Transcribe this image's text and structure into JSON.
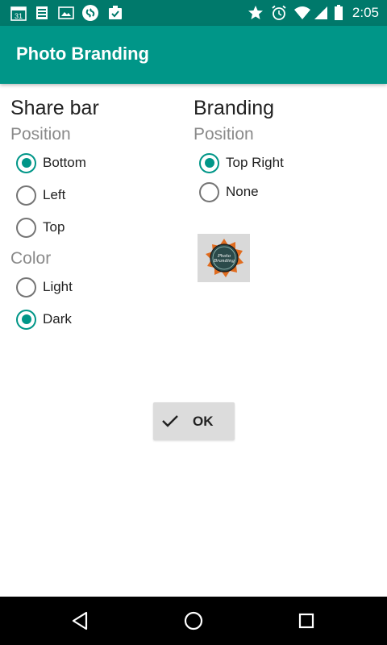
{
  "status_bar": {
    "time": "2:05",
    "calendar_day": "31",
    "left_icons": [
      "calendar-icon",
      "sheets-icon",
      "photos-icon",
      "shazam-icon",
      "task-icon"
    ],
    "right_icons": [
      "star-icon",
      "alarm-icon",
      "wifi-icon",
      "signal-icon",
      "battery-icon"
    ]
  },
  "app_bar": {
    "title": "Photo Branding"
  },
  "share_bar": {
    "heading": "Share bar",
    "position_label": "Position",
    "position_options": [
      {
        "label": "Bottom",
        "checked": true
      },
      {
        "label": "Left",
        "checked": false
      },
      {
        "label": "Top",
        "checked": false
      }
    ],
    "color_label": "Color",
    "color_options": [
      {
        "label": "Light",
        "checked": false
      },
      {
        "label": "Dark",
        "checked": true
      }
    ]
  },
  "branding": {
    "heading": "Branding",
    "position_label": "Position",
    "position_options": [
      {
        "label": "Top Right",
        "checked": true
      },
      {
        "label": "None",
        "checked": false
      }
    ],
    "logo_text": "Photo Branding"
  },
  "ok_button": {
    "label": "OK"
  },
  "colors": {
    "accent": "#009688",
    "status_bar": "#00796b",
    "nav_bar": "#000000"
  }
}
